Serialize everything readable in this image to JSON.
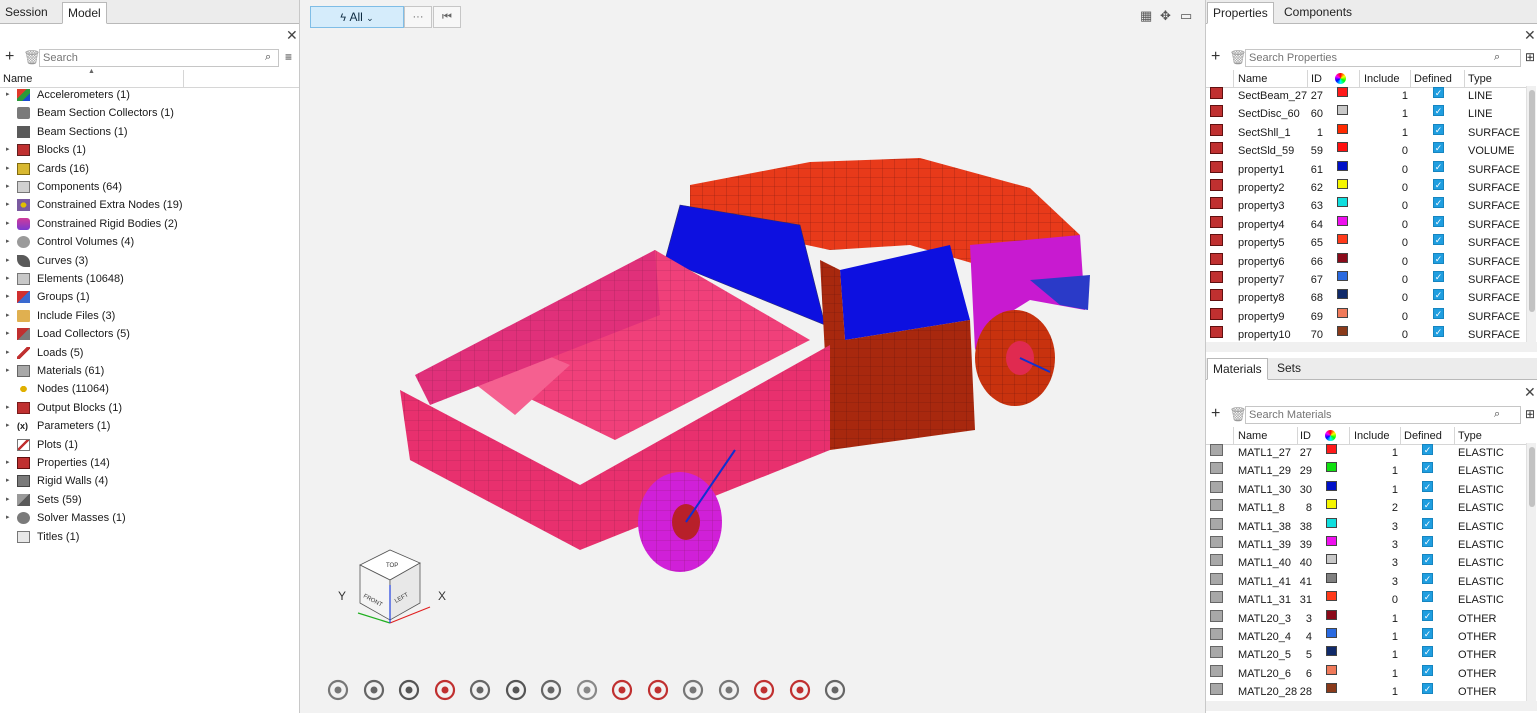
{
  "left_panel": {
    "tabs": [
      "Session",
      "Model"
    ],
    "search_placeholder": "Search",
    "header_name": "Name",
    "tree": [
      {
        "label": "Accelerometers  (1)",
        "icon": "accelerometer-icon",
        "expand": true
      },
      {
        "label": "Beam Section Collectors  (1)",
        "icon": "beam-section-collector-icon",
        "expand": false
      },
      {
        "label": "Beam Sections  (1)",
        "icon": "beam-section-icon",
        "expand": false
      },
      {
        "label": "Blocks  (1)",
        "icon": "block-icon",
        "expand": true
      },
      {
        "label": "Cards  (16)",
        "icon": "card-icon",
        "expand": true
      },
      {
        "label": "Components  (64)",
        "icon": "component-icon",
        "expand": true
      },
      {
        "label": "Constrained Extra Nodes  (19)",
        "icon": "constrained-extra-nodes-icon",
        "expand": true
      },
      {
        "label": "Constrained Rigid Bodies  (2)",
        "icon": "constrained-rigid-body-icon",
        "expand": true
      },
      {
        "label": "Control Volumes  (4)",
        "icon": "control-volume-icon",
        "expand": true
      },
      {
        "label": "Curves  (3)",
        "icon": "curve-icon",
        "expand": true
      },
      {
        "label": "Elements  (10648)",
        "icon": "element-icon",
        "expand": true
      },
      {
        "label": "Groups  (1)",
        "icon": "group-icon",
        "expand": true
      },
      {
        "label": "Include Files  (3)",
        "icon": "include-file-icon",
        "expand": true
      },
      {
        "label": "Load Collectors  (5)",
        "icon": "load-collector-icon",
        "expand": true
      },
      {
        "label": "Loads  (5)",
        "icon": "load-icon",
        "expand": true
      },
      {
        "label": "Materials  (61)",
        "icon": "material-icon",
        "expand": true
      },
      {
        "label": "Nodes  (11064)",
        "icon": "node-icon",
        "expand": false
      },
      {
        "label": "Output Blocks  (1)",
        "icon": "output-block-icon",
        "expand": true
      },
      {
        "label": "Parameters  (1)",
        "icon": "parameter-icon",
        "expand": true
      },
      {
        "label": "Plots  (1)",
        "icon": "plot-icon",
        "expand": false
      },
      {
        "label": "Properties  (14)",
        "icon": "property-icon",
        "expand": true
      },
      {
        "label": "Rigid Walls  (4)",
        "icon": "rigid-wall-icon",
        "expand": true
      },
      {
        "label": "Sets  (59)",
        "icon": "set-icon",
        "expand": true
      },
      {
        "label": "Solver Masses  (1)",
        "icon": "solver-mass-icon",
        "expand": true
      },
      {
        "label": "Titles  (1)",
        "icon": "title-icon",
        "expand": false
      }
    ]
  },
  "viewport": {
    "filter_label": "All",
    "more_label": "···",
    "axis_x": "X",
    "axis_y": "Y",
    "cube_faces": {
      "front": "FRONT",
      "left": "LEFT",
      "top": "TOP"
    }
  },
  "properties_panel": {
    "tabs": [
      "Properties",
      "Components"
    ],
    "search_placeholder": "Search Properties",
    "columns": [
      "Name",
      "ID",
      "Include",
      "Defined",
      "Type"
    ],
    "rows": [
      {
        "name": "SectBeam_27",
        "id": "27",
        "color": "#ff1a1a",
        "include": "1",
        "type": "LINE"
      },
      {
        "name": "SectDisc_60",
        "id": "60",
        "color": "#c8c8c8",
        "include": "1",
        "type": "LINE"
      },
      {
        "name": "SectShll_1",
        "id": "1",
        "color": "#ff2a00",
        "include": "1",
        "type": "SURFACE"
      },
      {
        "name": "SectSld_59",
        "id": "59",
        "color": "#ff1010",
        "include": "0",
        "type": "VOLUME"
      },
      {
        "name": "property1",
        "id": "61",
        "color": "#0010c8",
        "include": "0",
        "type": "SURFACE"
      },
      {
        "name": "property2",
        "id": "62",
        "color": "#f5f500",
        "include": "0",
        "type": "SURFACE"
      },
      {
        "name": "property3",
        "id": "63",
        "color": "#10dede",
        "include": "0",
        "type": "SURFACE"
      },
      {
        "name": "property4",
        "id": "64",
        "color": "#ee10ee",
        "include": "0",
        "type": "SURFACE"
      },
      {
        "name": "property5",
        "id": "65",
        "color": "#ff3a1a",
        "include": "0",
        "type": "SURFACE"
      },
      {
        "name": "property6",
        "id": "66",
        "color": "#8a0a1a",
        "include": "0",
        "type": "SURFACE"
      },
      {
        "name": "property7",
        "id": "67",
        "color": "#2a6ae0",
        "include": "0",
        "type": "SURFACE"
      },
      {
        "name": "property8",
        "id": "68",
        "color": "#102a6a",
        "include": "0",
        "type": "SURFACE"
      },
      {
        "name": "property9",
        "id": "69",
        "color": "#f07a5a",
        "include": "0",
        "type": "SURFACE"
      },
      {
        "name": "property10",
        "id": "70",
        "color": "#8a3a1a",
        "include": "0",
        "type": "SURFACE"
      }
    ]
  },
  "materials_panel": {
    "tabs": [
      "Materials",
      "Sets"
    ],
    "search_placeholder": "Search Materials",
    "columns": [
      "Name",
      "ID",
      "Include",
      "Defined",
      "Type"
    ],
    "rows": [
      {
        "name": "MATL1_27",
        "id": "27",
        "color": "#ff1a1a",
        "include": "1",
        "type": "ELASTIC"
      },
      {
        "name": "MATL1_29",
        "id": "29",
        "color": "#10e010",
        "include": "1",
        "type": "ELASTIC"
      },
      {
        "name": "MATL1_30",
        "id": "30",
        "color": "#0010c8",
        "include": "1",
        "type": "ELASTIC"
      },
      {
        "name": "MATL1_8",
        "id": "8",
        "color": "#f5f500",
        "include": "2",
        "type": "ELASTIC"
      },
      {
        "name": "MATL1_38",
        "id": "38",
        "color": "#10dede",
        "include": "3",
        "type": "ELASTIC"
      },
      {
        "name": "MATL1_39",
        "id": "39",
        "color": "#ee10ee",
        "include": "3",
        "type": "ELASTIC"
      },
      {
        "name": "MATL1_40",
        "id": "40",
        "color": "#c8c8c8",
        "include": "3",
        "type": "ELASTIC"
      },
      {
        "name": "MATL1_41",
        "id": "41",
        "color": "#808080",
        "include": "3",
        "type": "ELASTIC"
      },
      {
        "name": "MATL1_31",
        "id": "31",
        "color": "#ff3a1a",
        "include": "0",
        "type": "ELASTIC"
      },
      {
        "name": "MATL20_3",
        "id": "3",
        "color": "#8a0a1a",
        "include": "1",
        "type": "OTHER"
      },
      {
        "name": "MATL20_4",
        "id": "4",
        "color": "#2a6ae0",
        "include": "1",
        "type": "OTHER"
      },
      {
        "name": "MATL20_5",
        "id": "5",
        "color": "#102a6a",
        "include": "1",
        "type": "OTHER"
      },
      {
        "name": "MATL20_6",
        "id": "6",
        "color": "#f07a5a",
        "include": "1",
        "type": "OTHER"
      },
      {
        "name": "MATL20_28",
        "id": "28",
        "color": "#8a3a1a",
        "include": "1",
        "type": "OTHER"
      }
    ]
  },
  "bottom_toolbar": [
    "show-hide-icon",
    "globe-icon",
    "binoculars-icon",
    "focus-icon",
    "camera-icon",
    "collectors-icon",
    "section-icon",
    "component-color-icon",
    "property-color-icon",
    "material-color-icon",
    "ghost-icon",
    "axis-icon",
    "zoom-icon",
    "mesh-icon",
    "lock-icon"
  ]
}
